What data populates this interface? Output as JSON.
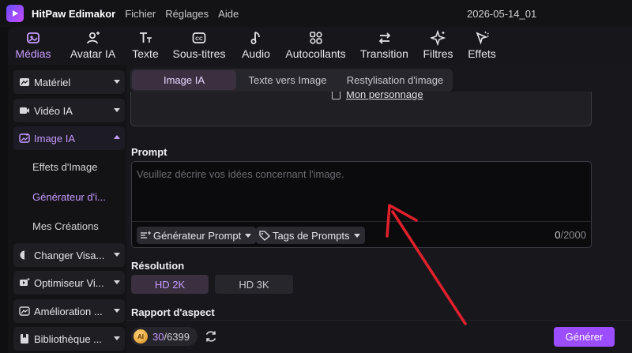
{
  "app": {
    "name": "HitPaw Edimakor",
    "project": "2026-05-14_01"
  },
  "menu": [
    "Fichier",
    "Réglages",
    "Aide"
  ],
  "toolbar": {
    "items": [
      {
        "label": "Médias",
        "icon": "media-icon"
      },
      {
        "label": "Avatar IA",
        "icon": "avatar-icon"
      },
      {
        "label": "Texte",
        "icon": "text-icon"
      },
      {
        "label": "Sous-titres",
        "icon": "subtitles-icon"
      },
      {
        "label": "Audio",
        "icon": "audio-icon"
      },
      {
        "label": "Autocollants",
        "icon": "stickers-icon"
      },
      {
        "label": "Transition",
        "icon": "transition-icon"
      },
      {
        "label": "Filtres",
        "icon": "filters-icon"
      },
      {
        "label": "Effets",
        "icon": "effects-icon"
      }
    ],
    "active": "Médias"
  },
  "sidebar": {
    "items": [
      {
        "label": "Matériel"
      },
      {
        "label": "Vidéo IA"
      },
      {
        "label": "Image IA"
      },
      {
        "label": "Changer Visa..."
      },
      {
        "label": "Optimiseur Vi..."
      },
      {
        "label": "Amélioration ..."
      },
      {
        "label": "Bibliothèque ..."
      }
    ],
    "subitems": [
      {
        "label": "Effets d'Image"
      },
      {
        "label": "Générateur d'i..."
      },
      {
        "label": "Mes Créations"
      }
    ]
  },
  "tabs": [
    "Image IA",
    "Texte vers Image",
    "Restylisation d'image"
  ],
  "character_link": "Mon personnage",
  "prompt": {
    "label": "Prompt",
    "placeholder": "Veuillez décrire vos idées concernant l'image.",
    "generator_label": "Générateur Prompt",
    "tags_label": "Tags de Prompts",
    "count": "0",
    "max": "/2000"
  },
  "resolution": {
    "label": "Résolution",
    "options": [
      "HD 2K",
      "HD 3K"
    ],
    "selected": "HD 2K"
  },
  "aspect_label": "Rapport d'aspect",
  "credits": {
    "current": "30",
    "total": "/6399",
    "coin": "AI"
  },
  "generate_label": "Générer",
  "colors": {
    "accent": "#c79bff",
    "button": "#9b4dff",
    "arrow": "#e0202c"
  }
}
